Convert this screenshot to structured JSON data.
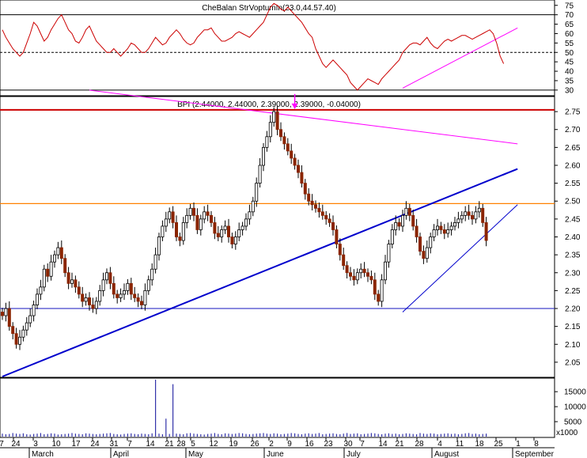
{
  "chart_data": [
    {
      "type": "line",
      "panel": "indicator",
      "header": "CheBalan StrVoptumIn(23.0,44.57.40)",
      "value_rule": 50,
      "ylim": [
        27,
        77
      ],
      "yticks": [
        30,
        35,
        40,
        45,
        50,
        55,
        60,
        65,
        70,
        75
      ],
      "guide_lines": [
        30,
        70
      ],
      "color": "#cc0000",
      "values": [
        62,
        58,
        55,
        52,
        50,
        48,
        50,
        55,
        60,
        66,
        64,
        60,
        56,
        58,
        62,
        65,
        68,
        70,
        66,
        62,
        60,
        56,
        55,
        58,
        62,
        64,
        60,
        56,
        54,
        52,
        50,
        50,
        52,
        50,
        48,
        50,
        52,
        55,
        54,
        52,
        50,
        50,
        52,
        55,
        58,
        56,
        54,
        55,
        58,
        60,
        62,
        60,
        57,
        55,
        54,
        55,
        58,
        60,
        62,
        62,
        63,
        60,
        58,
        56,
        56,
        57,
        58,
        60,
        61,
        60,
        59,
        58,
        60,
        62,
        64,
        66,
        70,
        74,
        76,
        75,
        73,
        72,
        74,
        72,
        70,
        68,
        66,
        63,
        60,
        58,
        52,
        48,
        44,
        42,
        44,
        46,
        44,
        42,
        40,
        38,
        34,
        32,
        30,
        32,
        34,
        36,
        35,
        34,
        33,
        36,
        38,
        40,
        42,
        44,
        46,
        50,
        52,
        54,
        55,
        55,
        54,
        56,
        58,
        55,
        53,
        52,
        54,
        56,
        57,
        56,
        57,
        58,
        59,
        59,
        58,
        57,
        58,
        59,
        60,
        61,
        62,
        60,
        55,
        48,
        44
      ],
      "trendlines": [
        {
          "from": [
            115,
            31
          ],
          "to": [
            148,
            63
          ],
          "color": "#ff00ff"
        }
      ]
    },
    {
      "type": "candlestick",
      "panel": "price",
      "series_label": "BPI (2.44000, 2.44000, 2.39000, 2.39000, -0.04000)",
      "ylim": [
        2.01,
        2.79
      ],
      "yticks": [
        2.05,
        2.1,
        2.15,
        2.2,
        2.25,
        2.3,
        2.35,
        2.4,
        2.45,
        2.5,
        2.55,
        2.6,
        2.65,
        2.7,
        2.75
      ],
      "up_color": "#ffffff",
      "down_color": "#8b2500",
      "closes": [
        2.18,
        2.2,
        2.15,
        2.13,
        2.1,
        2.12,
        2.14,
        2.16,
        2.18,
        2.21,
        2.24,
        2.26,
        2.31,
        2.29,
        2.33,
        2.35,
        2.37,
        2.34,
        2.3,
        2.27,
        2.28,
        2.26,
        2.24,
        2.22,
        2.23,
        2.21,
        2.2,
        2.22,
        2.25,
        2.28,
        2.3,
        2.27,
        2.24,
        2.23,
        2.24,
        2.25,
        2.27,
        2.24,
        2.23,
        2.22,
        2.21,
        2.25,
        2.28,
        2.31,
        2.35,
        2.4,
        2.43,
        2.45,
        2.47,
        2.44,
        2.4,
        2.39,
        2.44,
        2.46,
        2.48,
        2.46,
        2.42,
        2.45,
        2.47,
        2.46,
        2.44,
        2.41,
        2.4,
        2.42,
        2.43,
        2.4,
        2.38,
        2.4,
        2.42,
        2.43,
        2.45,
        2.47,
        2.5,
        2.55,
        2.6,
        2.65,
        2.68,
        2.72,
        2.75,
        2.7,
        2.68,
        2.66,
        2.64,
        2.62,
        2.6,
        2.58,
        2.55,
        2.52,
        2.5,
        2.49,
        2.48,
        2.47,
        2.46,
        2.45,
        2.44,
        2.42,
        2.38,
        2.35,
        2.32,
        2.3,
        2.29,
        2.28,
        2.3,
        2.31,
        2.3,
        2.29,
        2.28,
        2.24,
        2.22,
        2.28,
        2.33,
        2.38,
        2.42,
        2.44,
        2.43,
        2.46,
        2.48,
        2.46,
        2.43,
        2.4,
        2.36,
        2.34,
        2.37,
        2.4,
        2.42,
        2.43,
        2.42,
        2.41,
        2.42,
        2.43,
        2.44,
        2.45,
        2.46,
        2.47,
        2.46,
        2.45,
        2.47,
        2.48,
        2.44,
        2.39
      ],
      "hlines": [
        {
          "value": 2.755,
          "color": "#cc0000"
        },
        {
          "value": 2.493,
          "color": "#ff8000"
        },
        {
          "value": 2.2,
          "color": "#4444cc"
        }
      ],
      "trendlines": [
        {
          "from": [
            0,
            2.01
          ],
          "to": [
            148,
            2.59
          ],
          "color": "#0000cc"
        },
        {
          "from": [
            115,
            2.19
          ],
          "to": [
            148,
            2.49
          ],
          "color": "#0000cc"
        },
        {
          "from": [
            25,
            2.81
          ],
          "to": [
            148,
            2.66
          ],
          "color": "#ff00ff"
        }
      ],
      "arrow_at_index": 84
    },
    {
      "type": "bar",
      "panel": "volume",
      "multiplier_label": "x1000",
      "ylim": [
        0,
        19000
      ],
      "yticks": [
        5000,
        10000,
        15000
      ],
      "values": [
        1000,
        800,
        900,
        1200,
        1000,
        900,
        1100,
        800,
        700,
        900,
        1000,
        1200,
        800,
        900,
        1100,
        1000,
        700,
        800,
        900,
        1000,
        1200,
        1000,
        900,
        800,
        1100,
        1000,
        900,
        800,
        900,
        1000,
        1100,
        1200,
        900,
        800,
        700,
        900,
        1000,
        1100,
        900,
        800,
        1000,
        900,
        800,
        1100,
        19000,
        1000,
        800,
        6000,
        900,
        17500,
        1000,
        900,
        800,
        1100,
        1200,
        1000,
        900,
        800,
        700,
        900,
        1000,
        1200,
        900,
        800,
        1100,
        1000,
        900,
        1000,
        1200,
        1100,
        900,
        800,
        900,
        1000,
        1100,
        1200,
        1000,
        900,
        1100,
        1000,
        800,
        900,
        1000,
        1200,
        1100,
        900,
        800,
        1000,
        1100,
        900,
        1000,
        1200,
        800,
        900,
        1000,
        1100,
        900,
        800,
        1000,
        1200,
        900,
        1000,
        1100,
        800,
        900,
        1000,
        1200,
        1100,
        900,
        800,
        1000,
        1100,
        900,
        1000,
        800,
        900,
        1100,
        1000,
        900,
        800,
        1200,
        1000,
        900,
        1100,
        1000,
        800,
        900,
        1000,
        1100,
        900,
        1000,
        800,
        900,
        1100,
        1200,
        900,
        1000,
        800,
        900,
        1000
      ]
    }
  ],
  "x_axis": {
    "day_ticks": [
      "7",
      "24",
      "3",
      "10",
      "17",
      "24",
      "31",
      "7",
      "14",
      "21",
      "28",
      "5",
      "12",
      "19",
      "26",
      "2",
      "9",
      "16",
      "23",
      "30",
      "7",
      "14",
      "21",
      "28",
      "4",
      "11",
      "18",
      "25",
      "1",
      "8"
    ],
    "months": [
      "March",
      "April",
      "May",
      "June",
      "July",
      "August",
      "September"
    ]
  }
}
